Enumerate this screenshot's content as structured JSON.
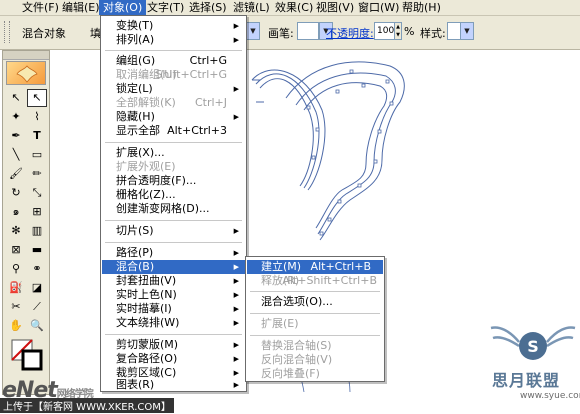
{
  "menubar": {
    "items": [
      "文件(F)",
      "编辑(E)",
      "对象(O)",
      "文字(T)",
      "选择(S)",
      "滤镜(L)",
      "效果(C)",
      "视图(V)",
      "窗口(W)",
      "帮助(H)"
    ],
    "active_index": 2
  },
  "controlbar": {
    "title": "混合对象",
    "fill_label": "填",
    "stroke_label": "画笔:",
    "opacity_label": "不透明度:",
    "opacity_value": "100",
    "opacity_unit": "%",
    "style_label": "样式:"
  },
  "object_menu": {
    "items": [
      {
        "label": "变换(T)",
        "shortcut": "",
        "submenu": true,
        "disabled": false
      },
      {
        "label": "排列(A)",
        "shortcut": "",
        "submenu": true,
        "disabled": false
      },
      {
        "sep": true
      },
      {
        "label": "编组(G)",
        "shortcut": "Ctrl+G",
        "submenu": false,
        "disabled": false
      },
      {
        "label": "取消编组(U)",
        "shortcut": "Shift+Ctrl+G",
        "submenu": false,
        "disabled": true
      },
      {
        "label": "锁定(L)",
        "shortcut": "",
        "submenu": true,
        "disabled": false
      },
      {
        "label": "全部解锁(K)",
        "shortcut": "Ctrl+J",
        "submenu": false,
        "disabled": true
      },
      {
        "label": "隐藏(H)",
        "shortcut": "",
        "submenu": true,
        "disabled": false
      },
      {
        "label": "显示全部",
        "shortcut": "Alt+Ctrl+3",
        "submenu": false,
        "disabled": false
      },
      {
        "sep": true
      },
      {
        "label": "扩展(X)...",
        "shortcut": "",
        "submenu": false,
        "disabled": false
      },
      {
        "label": "扩展外观(E)",
        "shortcut": "",
        "submenu": false,
        "disabled": true
      },
      {
        "label": "拼合透明度(F)...",
        "shortcut": "",
        "submenu": false,
        "disabled": false
      },
      {
        "label": "栅格化(Z)...",
        "shortcut": "",
        "submenu": false,
        "disabled": false
      },
      {
        "label": "创建渐变网格(D)...",
        "shortcut": "",
        "submenu": false,
        "disabled": false
      },
      {
        "sep": true
      },
      {
        "label": "切片(S)",
        "shortcut": "",
        "submenu": true,
        "disabled": false
      },
      {
        "sep": true
      },
      {
        "label": "路径(P)",
        "shortcut": "",
        "submenu": true,
        "disabled": false
      },
      {
        "label": "混合(B)",
        "shortcut": "",
        "submenu": true,
        "disabled": false,
        "highlight": true
      },
      {
        "label": "封套扭曲(V)",
        "shortcut": "",
        "submenu": true,
        "disabled": false
      },
      {
        "label": "实时上色(N)",
        "shortcut": "",
        "submenu": true,
        "disabled": false
      },
      {
        "label": "实时描摹(I)",
        "shortcut": "",
        "submenu": true,
        "disabled": false
      },
      {
        "label": "文本绕排(W)",
        "shortcut": "",
        "submenu": true,
        "disabled": false
      },
      {
        "sep": true
      },
      {
        "label": "剪切蒙版(M)",
        "shortcut": "",
        "submenu": true,
        "disabled": false
      },
      {
        "label": "复合路径(O)",
        "shortcut": "",
        "submenu": true,
        "disabled": false
      },
      {
        "label": "裁剪区域(C)",
        "shortcut": "",
        "submenu": true,
        "disabled": false
      },
      {
        "label": "图表(R)",
        "shortcut": "",
        "submenu": true,
        "disabled": false
      }
    ]
  },
  "blend_submenu": {
    "items": [
      {
        "label": "建立(M)",
        "shortcut": "Alt+Ctrl+B",
        "disabled": false,
        "highlight": true
      },
      {
        "label": "释放(R)",
        "shortcut": "Alt+Shift+Ctrl+B",
        "disabled": true
      },
      {
        "sep": true
      },
      {
        "label": "混合选项(O)...",
        "shortcut": "",
        "disabled": false
      },
      {
        "sep": true
      },
      {
        "label": "扩展(E)",
        "shortcut": "",
        "disabled": true
      },
      {
        "sep": true
      },
      {
        "label": "替换混合轴(S)",
        "shortcut": "",
        "disabled": true
      },
      {
        "label": "反向混合轴(V)",
        "shortcut": "",
        "disabled": true
      },
      {
        "label": "反向堆叠(F)",
        "shortcut": "",
        "disabled": true
      }
    ]
  },
  "watermark": {
    "brand": "eNet",
    "brand_suffix": "网络学院",
    "caption": "上传于【新客网 WWW.XKER.COM】",
    "site_cn": "思月联盟",
    "site_url": "www.syue.com"
  },
  "colors": {
    "menu_highlight": "#316ac5",
    "path_stroke": "#4d6aa8",
    "ui_face": "#ece9d8"
  }
}
